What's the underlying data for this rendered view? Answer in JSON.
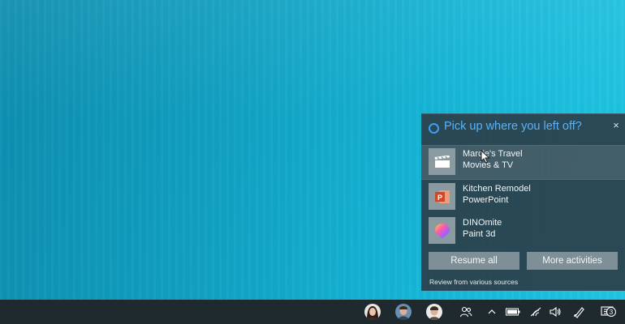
{
  "timeline": {
    "title": "Pick up where you left off?",
    "close_glyph": "×",
    "items": [
      {
        "title": "Marcie's Travel",
        "app": "Movies & TV",
        "icon": "movie-clapperboard-icon"
      },
      {
        "title": "Kitchen Remodel",
        "app": "PowerPoint",
        "icon": "powerpoint-icon"
      },
      {
        "title": "DINOmite",
        "app": "Paint 3d",
        "icon": "paint3d-icon"
      }
    ],
    "resume_label": "Resume all",
    "more_label": "More activities",
    "footer": "Review from various sources",
    "accent_color": "#5ab2f5"
  },
  "taskbar": {
    "notification_count": "3",
    "contacts": [
      "contact-avatar-1",
      "contact-avatar-2",
      "contact-avatar-3"
    ],
    "tray_icons": [
      "people-icon",
      "chevron-up-icon",
      "battery-icon",
      "wifi-icon",
      "volume-icon",
      "pen-icon",
      "action-center-icon"
    ]
  }
}
